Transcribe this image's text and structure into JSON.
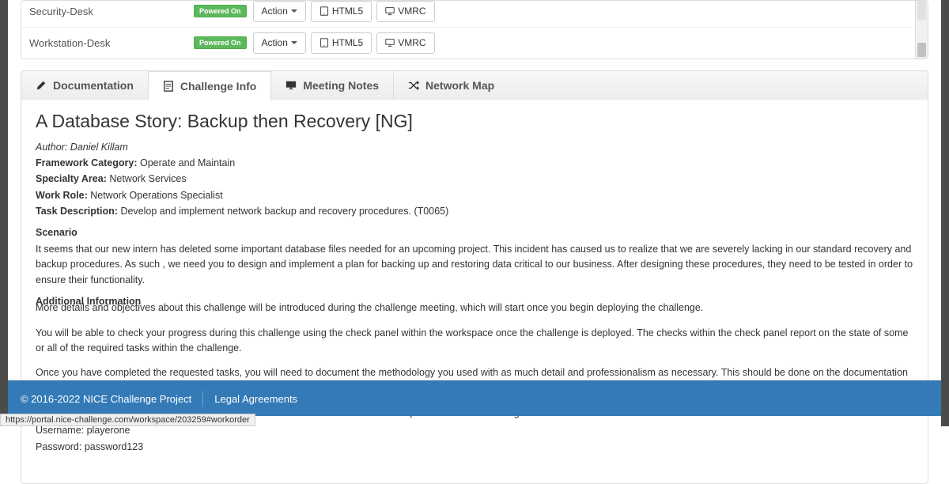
{
  "vms": [
    {
      "name": "Security-Desk",
      "status": "Powered On",
      "action": "Action",
      "html5": "HTML5",
      "vmrc": "VMRC"
    },
    {
      "name": "Workstation-Desk",
      "status": "Powered On",
      "action": "Action",
      "html5": "HTML5",
      "vmrc": "VMRC"
    }
  ],
  "tabs": {
    "doc": "Documentation",
    "challenge": "Challenge Info",
    "meeting": "Meeting Notes",
    "network": "Network Map"
  },
  "challenge": {
    "title": "A Database Story: Backup then Recovery [NG]",
    "author_label": "Author:",
    "author": "Daniel Killam",
    "framework_label": "Framework Category:",
    "framework": "Operate and Maintain",
    "specialty_label": "Specialty Area:",
    "specialty": "Network Services",
    "role_label": "Work Role:",
    "role": "Network Operations Specialist",
    "task_label": "Task Description:",
    "task": "Develop and implement network backup and recovery procedures. (T0065)",
    "scenario_head": "Scenario",
    "scenario": "It seems that our new intern has deleted some important database files needed for an upcoming project. This incident has caused us to realize that we are severely lacking in our standard recovery and backup procedures. As such , we need you to design and implement a plan for backing up and restoring data critical to our business. After designing these procedures, they need to be tested in order to ensure their functionality.",
    "addl_head": "Additional Information",
    "p1": "More details and objectives about this challenge will be introduced during the challenge meeting, which will start once you begin deploying the challenge.",
    "p2": "You will be able to check your progress during this challenge using the check panel within the workspace once the challenge is deployed. The checks within the check panel report on the state of some or all of the required tasks within the challenge.",
    "p3": "Once you have completed the requested tasks, you will need to document the methodology you used with as much detail and professionalism as necessary. This should be done on the documentation tab within the workspace once the challenge is deployed. Below the main documentation section be sure to include a tagged list of applications you used to complete the challenge.",
    "p4": "Your username/password to access all virtual machines and services within the workspace will be the following...",
    "user_line": "Username: playerone",
    "pass_line": "Password: password123"
  },
  "footer": {
    "copyright": "© 2016-2022 NICE Challenge Project",
    "legal": "Legal Agreements"
  },
  "statusbar": "https://portal.nice-challenge.com/workspace/203259#workorder"
}
